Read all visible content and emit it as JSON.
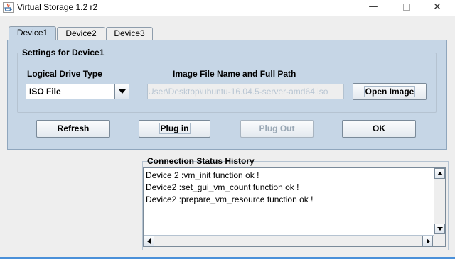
{
  "window": {
    "title": "Virtual Storage 1.2 r2",
    "min_glyph": "—",
    "close_glyph": "✕"
  },
  "tabs": [
    {
      "label": "Device1",
      "active": true
    },
    {
      "label": "Device2",
      "active": false
    },
    {
      "label": "Device3",
      "active": false
    }
  ],
  "settings": {
    "group_title": "Settings for Device1",
    "drive_type_label": "Logical Drive Type",
    "drive_type_value": "ISO File",
    "image_path_label": "Image File Name and Full Path",
    "image_path_value": "User\\Desktop\\ubuntu-16.04.5-server-amd64.iso",
    "open_image_label": "Open Image"
  },
  "actions": {
    "refresh": "Refresh",
    "plug_in": "Plug in",
    "plug_out": "Plug Out",
    "ok": "OK"
  },
  "status": {
    "title": "Connection Status History",
    "lines": [
      "Device 2 :vm_init function ok !",
      "Device2 :set_gui_vm_count function ok !",
      "Device2 :prepare_vm_resource function ok !"
    ]
  },
  "colors": {
    "panel": "#c6d6e6",
    "window": "#eeeeee",
    "accent_line": "#4a90d9"
  },
  "icons": [
    "java-app-icon",
    "minimize-icon",
    "maximize-icon",
    "close-icon",
    "dropdown-arrow-icon",
    "scroll-up-icon",
    "scroll-down-icon",
    "scroll-left-icon",
    "scroll-right-icon"
  ]
}
